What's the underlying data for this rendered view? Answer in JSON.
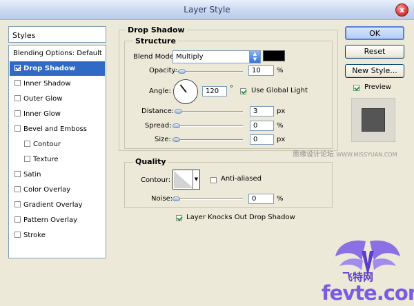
{
  "window": {
    "title": "Layer Style",
    "close_glyph": "x"
  },
  "sidebar": {
    "header": "Styles",
    "items": [
      {
        "label": "Blending Options: Default",
        "checkbox": false,
        "checked": false,
        "selected": false,
        "indent": false
      },
      {
        "label": "Drop Shadow",
        "checkbox": true,
        "checked": true,
        "selected": true,
        "indent": false
      },
      {
        "label": "Inner Shadow",
        "checkbox": true,
        "checked": false,
        "selected": false,
        "indent": false
      },
      {
        "label": "Outer Glow",
        "checkbox": true,
        "checked": false,
        "selected": false,
        "indent": false
      },
      {
        "label": "Inner Glow",
        "checkbox": true,
        "checked": false,
        "selected": false,
        "indent": false
      },
      {
        "label": "Bevel and Emboss",
        "checkbox": true,
        "checked": false,
        "selected": false,
        "indent": false
      },
      {
        "label": "Contour",
        "checkbox": true,
        "checked": false,
        "selected": false,
        "indent": true
      },
      {
        "label": "Texture",
        "checkbox": true,
        "checked": false,
        "selected": false,
        "indent": true
      },
      {
        "label": "Satin",
        "checkbox": true,
        "checked": false,
        "selected": false,
        "indent": false
      },
      {
        "label": "Color Overlay",
        "checkbox": true,
        "checked": false,
        "selected": false,
        "indent": false
      },
      {
        "label": "Gradient Overlay",
        "checkbox": true,
        "checked": false,
        "selected": false,
        "indent": false
      },
      {
        "label": "Pattern Overlay",
        "checkbox": true,
        "checked": false,
        "selected": false,
        "indent": false
      },
      {
        "label": "Stroke",
        "checkbox": true,
        "checked": false,
        "selected": false,
        "indent": false
      }
    ]
  },
  "drop_shadow": {
    "title": "Drop Shadow",
    "structure": {
      "title": "Structure",
      "blend_mode_label": "Blend Mode:",
      "blend_mode_value": "Multiply",
      "shadow_color": "#000000",
      "opacity_label": "Opacity:",
      "opacity_value": "10",
      "opacity_unit": "%",
      "opacity_slider_pct": 10,
      "angle_label": "Angle:",
      "angle_value": "120",
      "angle_unit": "°",
      "use_global_light_label": "Use Global Light",
      "use_global_light_checked": true,
      "distance_label": "Distance:",
      "distance_value": "3",
      "distance_unit": "px",
      "spread_label": "Spread:",
      "spread_value": "0",
      "spread_unit": "%",
      "size_label": "Size:",
      "size_value": "0",
      "size_unit": "px"
    },
    "quality": {
      "title": "Quality",
      "contour_label": "Contour:",
      "anti_aliased_label": "Anti-aliased",
      "anti_aliased_checked": false,
      "noise_label": "Noise:",
      "noise_value": "0",
      "noise_unit": "%"
    },
    "knockout_label": "Layer Knocks Out Drop Shadow",
    "knockout_checked": true
  },
  "actions": {
    "ok_label": "OK",
    "reset_label": "Reset",
    "new_style_label": "New Style...",
    "preview_label": "Preview",
    "preview_checked": true
  },
  "watermark": {
    "text": "思缘设计论坛",
    "site": "WWW.MISSYUAN.COM"
  },
  "logo": {
    "cn": "飞特网",
    "brand": "fevte.com"
  }
}
